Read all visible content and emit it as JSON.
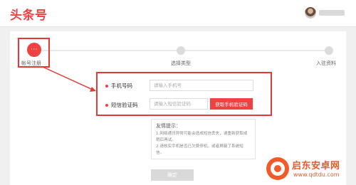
{
  "header": {
    "logo": "头条号"
  },
  "steps": [
    {
      "label": "帐号注册",
      "active": true,
      "indicator": "···"
    },
    {
      "label": "选择类型",
      "active": false
    },
    {
      "label": "入驻资料",
      "active": false
    }
  ],
  "form": {
    "phone_label": "手机号码",
    "phone_placeholder": "请输入手机号",
    "code_label": "短信验证码",
    "code_placeholder": "请输入短信验证码",
    "get_code_button": "获取手机验证码"
  },
  "tips": {
    "title": "友情提示：",
    "items": [
      "1.网络通讯异常可能会造成短信丢失，请重新获取或稍后再试。",
      "2.请核实手机是否已欠费停机，或者屏蔽了系统短信。"
    ]
  },
  "confirm_button": "确定",
  "watermark": {
    "title": "启东安卓网",
    "url": "www.qdtdu.com"
  },
  "colors": {
    "brand": "#f04142",
    "highlight": "#e53935",
    "watermark": "#e45c2b"
  }
}
